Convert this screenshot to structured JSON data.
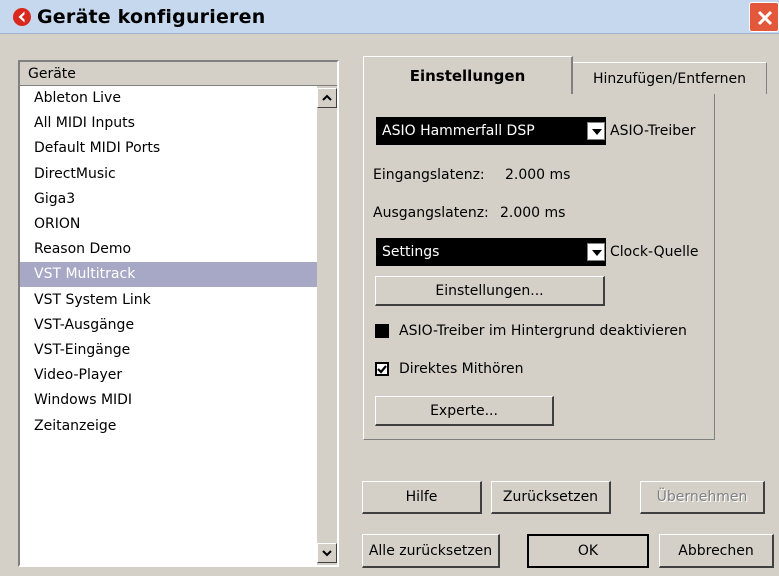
{
  "window": {
    "title": "Geräte konfigurieren"
  },
  "device_list": {
    "header": "Geräte",
    "items": [
      "Ableton Live",
      "All MIDI Inputs",
      "Default MIDI Ports",
      "DirectMusic",
      "Giga3",
      "ORION",
      "Reason Demo",
      "VST Multitrack",
      "VST System Link",
      "VST-Ausgänge",
      "VST-Eingänge",
      "Video-Player",
      "Windows MIDI",
      "Zeitanzeige"
    ],
    "selected": "VST Multitrack"
  },
  "tabs": {
    "settings": "Einstellungen",
    "add_remove": "Hinzufügen/Entfernen"
  },
  "settings": {
    "asio_driver_value": "ASIO Hammerfall DSP",
    "asio_driver_label": "ASIO-Treiber",
    "input_latency_label": "Eingangslatenz:",
    "input_latency_value": "2.000 ms",
    "output_latency_label": "Ausgangslatenz:",
    "output_latency_value": "2.000 ms",
    "clock_source_value": "Settings",
    "clock_source_label": "Clock-Quelle",
    "settings_button": "Einstellungen...",
    "deactivate_bg_label": "ASIO-Treiber im Hintergrund deaktivieren",
    "deactivate_bg_checked": false,
    "direct_monitoring_label": "Direktes Mithören",
    "direct_monitoring_checked": true,
    "expert_button": "Experte..."
  },
  "buttons": {
    "help": "Hilfe",
    "reset": "Zurücksetzen",
    "apply": "Übernehmen",
    "reset_all": "Alle zurücksetzen",
    "ok": "OK",
    "cancel": "Abbrechen"
  },
  "colors": {
    "title_bar": "#c6d8ee",
    "close_button": "#e3583b",
    "selection": "#a7a8c6",
    "dialog_bg": "#d4d0c8"
  }
}
